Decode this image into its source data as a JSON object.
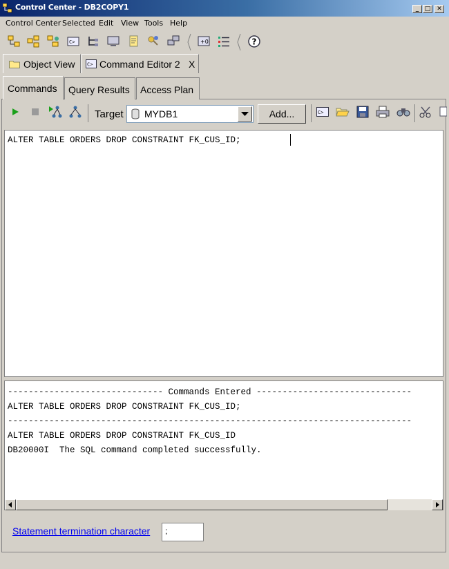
{
  "window": {
    "title": "Control Center - DB2COPY1",
    "min_icon": "minimize-icon",
    "max_icon": "maximize-icon",
    "close_icon": "close-icon"
  },
  "menu": [
    "Control Center",
    "Selected",
    "Edit",
    "View",
    "Tools",
    "Help"
  ],
  "toolbar": {
    "icons": [
      "object-tree-icon",
      "replicate-icon",
      "tree-group-icon",
      "command-editor-icon",
      "hierarchy-icon",
      "display-icon",
      "notes-icon",
      "key-user-icon",
      "network-icon",
      "screen-plus-icon",
      "task-list-icon",
      "help-icon"
    ]
  },
  "outer_tabs": {
    "object_view": "Object View",
    "command_editor": "Command Editor 2",
    "close_x": "X"
  },
  "inner_tabs": {
    "commands": "Commands",
    "query_results": "Query Results",
    "access_plan": "Access Plan"
  },
  "cmd_toolbar": {
    "target_label": "Target",
    "target_value": "MYDB1",
    "add_label": "Add...",
    "icons": [
      "run-icon",
      "stop-icon",
      "run-explain-icon",
      "explain-icon",
      "command-editor-icon",
      "open-folder-icon",
      "save-icon",
      "print-icon",
      "find-icon",
      "cut-icon",
      "copy-icon"
    ]
  },
  "editor": {
    "text": "ALTER TABLE ORDERS DROP CONSTRAINT FK_CUS_ID;"
  },
  "results": {
    "lines": [
      "------------------------------ Commands Entered ------------------------------",
      "ALTER TABLE ORDERS DROP CONSTRAINT FK_CUS_ID;",
      "------------------------------------------------------------------------------",
      "ALTER TABLE ORDERS DROP CONSTRAINT FK_CUS_ID",
      "DB20000I  The SQL command completed successfully."
    ]
  },
  "footer": {
    "termination_label": "Statement termination character",
    "termination_value": ";"
  },
  "colors": {
    "title_start": "#0a246a",
    "title_end": "#a6caf0",
    "link": "#0000ee",
    "chrome": "#d4d0c8"
  }
}
